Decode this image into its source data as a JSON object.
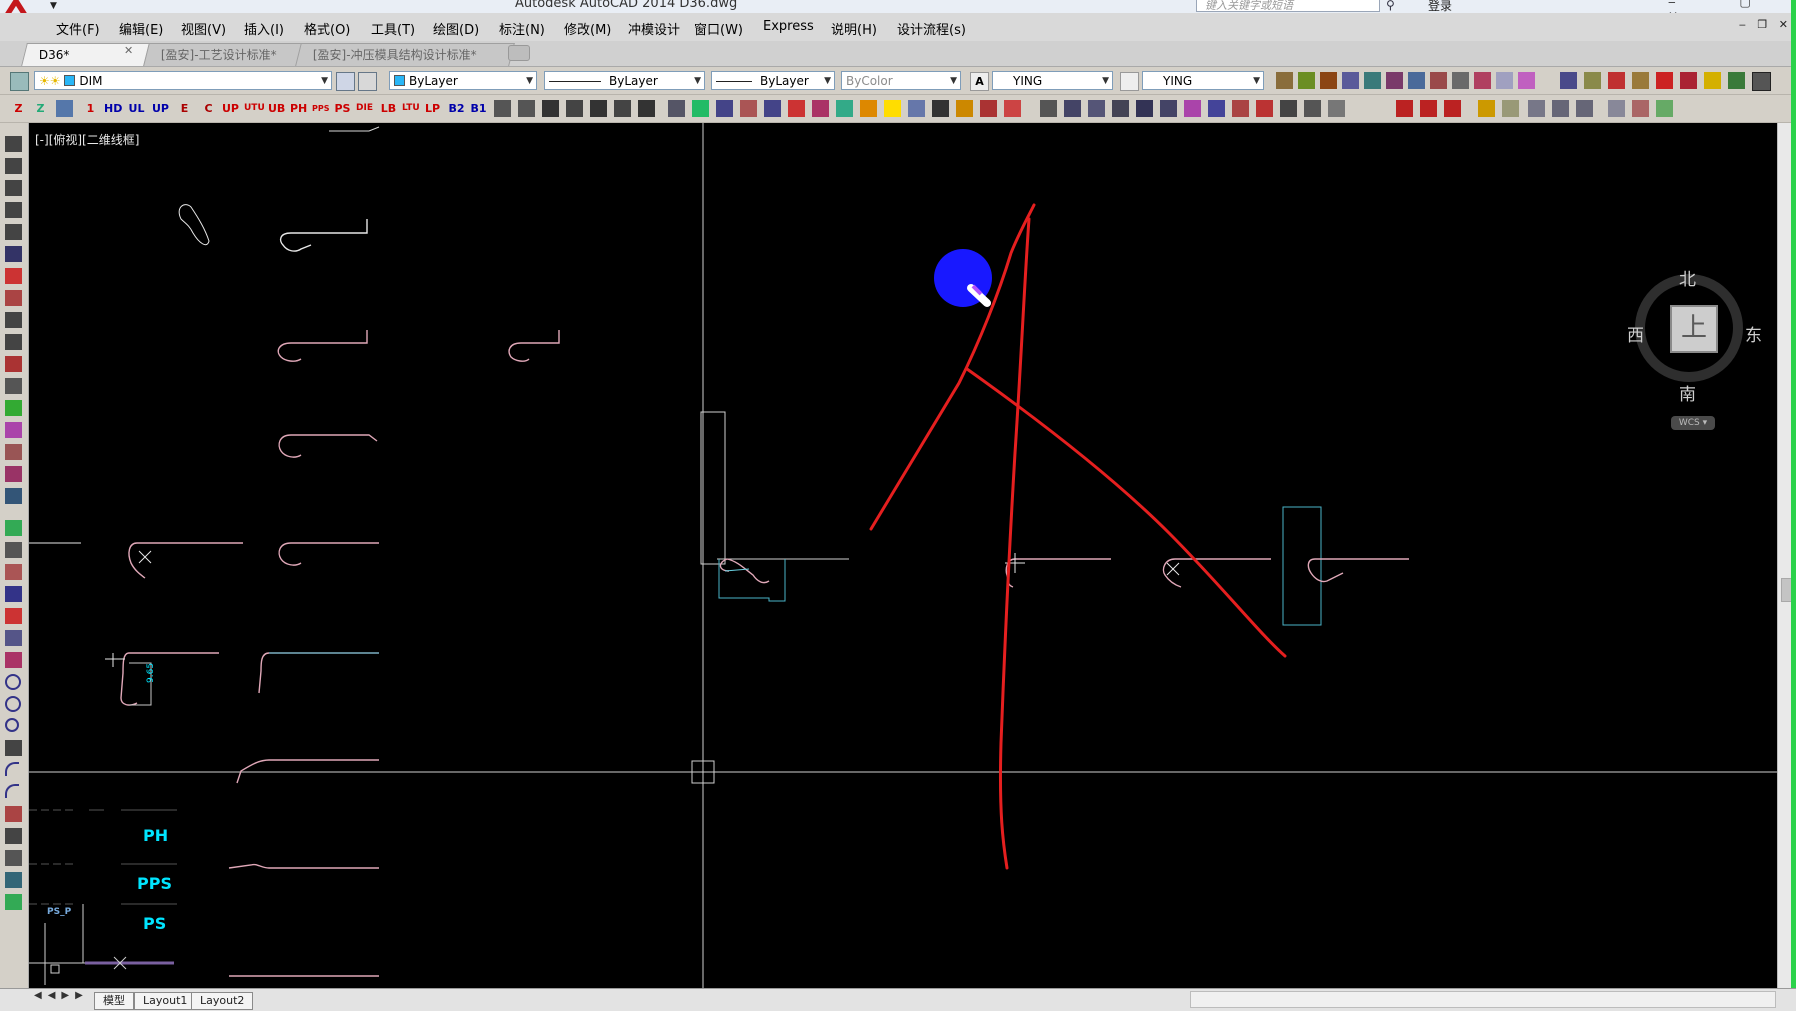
{
  "title_bar": {
    "title": "Autodesk AutoCAD 2014   D36.dwg",
    "search_placeholder": "键入关键字或短语",
    "login": "登录"
  },
  "menu": [
    "文件(F)",
    "编辑(E)",
    "视图(V)",
    "插入(I)",
    "格式(O)",
    "工具(T)",
    "绘图(D)",
    "标注(N)",
    "修改(M)",
    "冲模设计",
    "窗口(W)",
    "Express",
    "说明(H)",
    "设计流程(s)"
  ],
  "tabs": [
    "D36*",
    "[盈安]-工艺设计标准*",
    "[盈安]-冲压模具结构设计标准*"
  ],
  "toolbar": {
    "layer": "DIM",
    "color": "ByLayer",
    "linetype": "ByLayer",
    "lineweight": "ByLayer",
    "plotstyle": "ByColor",
    "text_style": "YING",
    "dim_style": "YING"
  },
  "row2_buttons": [
    "HD",
    "UL",
    "UP",
    "UTU",
    "UB",
    "PH",
    "PPS",
    "PS",
    "DIE",
    "LB",
    "LTU",
    "LP",
    "B2",
    "B1"
  ],
  "drawing": {
    "view_label": "[-][俯视][二维线框]",
    "viewcube": {
      "north": "北",
      "south": "南",
      "west": "西",
      "east": "东",
      "top": "上",
      "wcs": "WCS"
    },
    "labels": {
      "ph": "PH",
      "pps": "PPS",
      "ps": "PS",
      "ps_small": "PS_P",
      "dim_value": "9.65"
    }
  },
  "status": {
    "layout_tabs": [
      "模型",
      "Layout1",
      "Layout2"
    ]
  },
  "colors": {
    "background": "#000000",
    "annotation": "#e51f1f",
    "cursor_blue": "#1818ff",
    "cad_cyan": "#00e5ff",
    "line_white": "#e8e8e8"
  }
}
